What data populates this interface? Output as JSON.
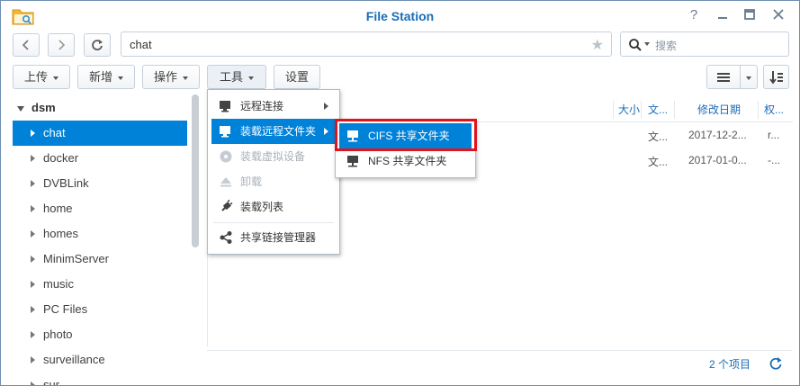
{
  "window": {
    "title": "File Station"
  },
  "nav": {
    "path": "chat",
    "search_placeholder": "搜索"
  },
  "toolbar": {
    "upload": "上传",
    "create": "新增",
    "action": "操作",
    "tools": "工具",
    "settings": "设置"
  },
  "tree": {
    "root": "dsm",
    "items": [
      "chat",
      "docker",
      "DVBLink",
      "home",
      "homes",
      "MinimServer",
      "music",
      "PC Files",
      "photo",
      "surveillance",
      "sur"
    ]
  },
  "list": {
    "columns": {
      "size": "大小",
      "type": "文...",
      "modified": "修改日期",
      "perm": "权..."
    },
    "rows": [
      {
        "type": "文...",
        "modified": "2017-12-2...",
        "perm": "r..."
      },
      {
        "type": "文...",
        "modified": "2017-01-0...",
        "perm": "-..."
      }
    ],
    "count": "2 个项目"
  },
  "tools_menu": {
    "items": [
      "远程连接",
      "装载远程文件夹",
      "装载虚拟设备",
      "卸载",
      "装载列表",
      "共享链接管理器"
    ]
  },
  "mount_submenu": {
    "items": [
      "CIFS 共享文件夹",
      "NFS 共享文件夹"
    ]
  },
  "colors": {
    "accent": "#0082d9",
    "title": "#1a6cb8",
    "highlight_frame": "#e0141e"
  }
}
